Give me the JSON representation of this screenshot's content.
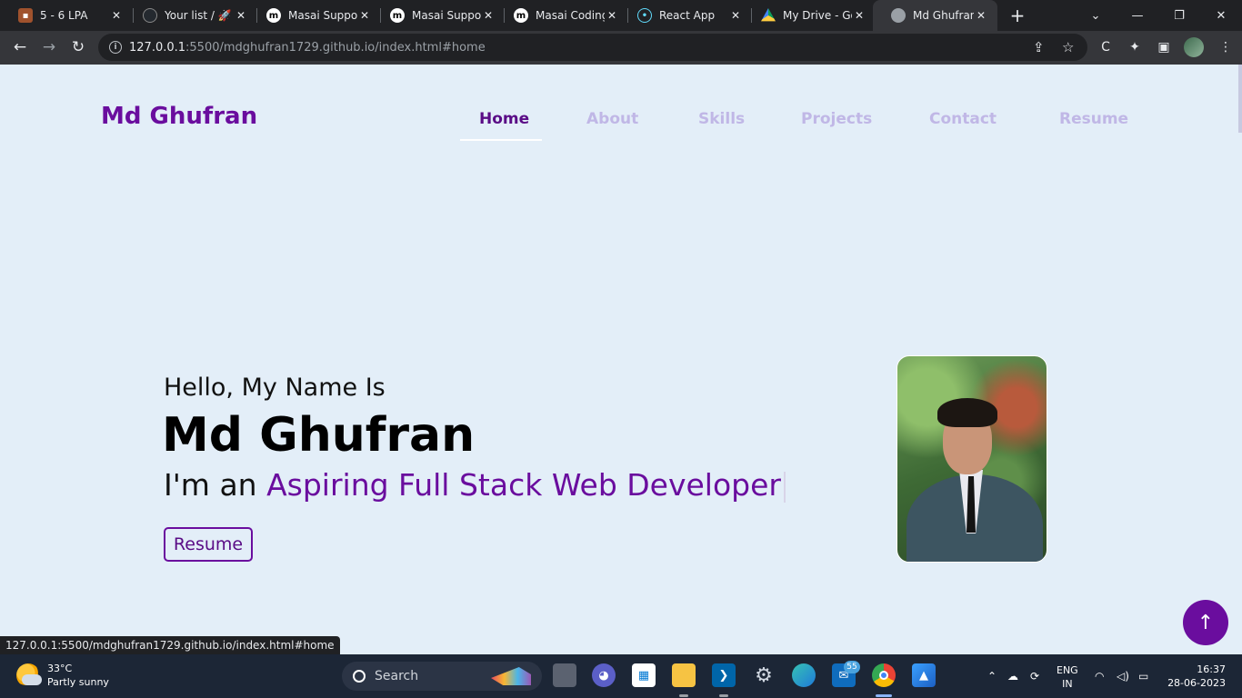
{
  "browser": {
    "tabs": [
      {
        "title": "5 - 6 LPA",
        "favicon": "briefcase-icon",
        "active": false
      },
      {
        "title": "Your list / 🚀",
        "favicon": "github-icon",
        "active": false
      },
      {
        "title": "Masai Suppor",
        "favicon": "masai-icon",
        "active": false
      },
      {
        "title": "Masai Suppor",
        "favicon": "masai-icon",
        "active": false
      },
      {
        "title": "Masai Coding",
        "favicon": "masai-icon",
        "active": false
      },
      {
        "title": "React App",
        "favicon": "react-icon",
        "active": false
      },
      {
        "title": "My Drive - Go",
        "favicon": "google-drive-icon",
        "active": false
      },
      {
        "title": "Md Ghufran |",
        "favicon": "globe-icon",
        "active": true
      }
    ],
    "url_host": "127.0.0.1",
    "url_rest": ":5500/mdghufran1729.github.io/index.html#home",
    "status_link": "127.0.0.1:5500/mdghufran1729.github.io/index.html#home"
  },
  "page": {
    "logo": "Md Ghufran",
    "nav": [
      "Home",
      "About",
      "Skills",
      "Projects",
      "Contact",
      "Resume"
    ],
    "active_nav": "Home",
    "hello": "Hello, My Name Is",
    "name": "Md Ghufran",
    "role_prefix": "I'm an ",
    "role_highlight": "Aspiring Full Stack Web Developer",
    "resume_button": "Resume",
    "accent_color": "#6a0d9e"
  },
  "taskbar": {
    "weather_temp": "33°C",
    "weather_desc": "Partly sunny",
    "search_label": "Search",
    "mail_badge": "55",
    "lang_top": "ENG",
    "lang_bottom": "IN",
    "time": "16:37",
    "date": "28-06-2023"
  }
}
